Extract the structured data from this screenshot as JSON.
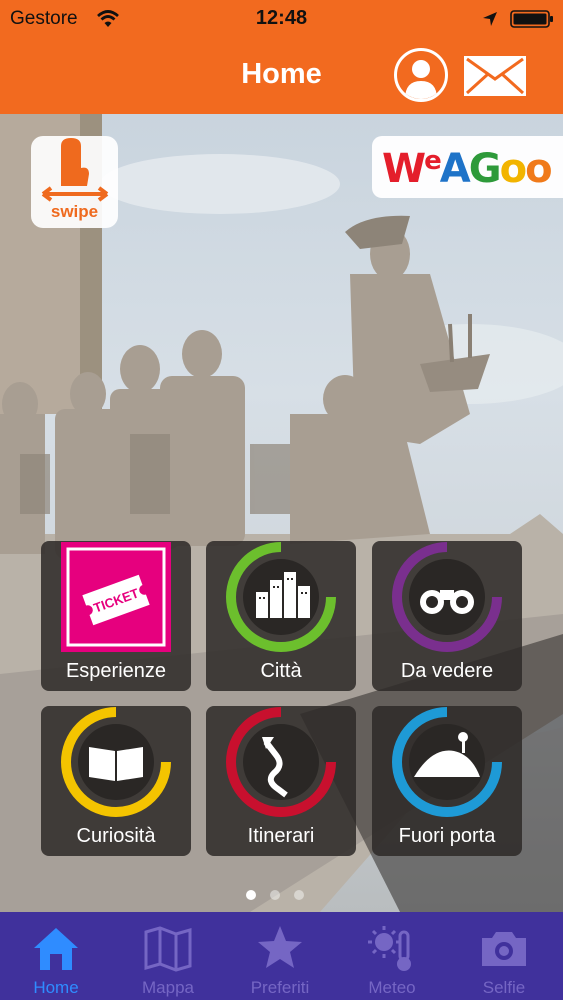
{
  "status_bar": {
    "carrier": "Gestore",
    "time": "12:48",
    "wifi_icon": "wifi-icon",
    "location_icon": "location-arrow-icon",
    "battery_icon": "battery-icon"
  },
  "header": {
    "title": "Home",
    "profile_icon": "user-icon",
    "mail_icon": "envelope-icon",
    "background_color": "#f26a1f"
  },
  "overlay": {
    "swipe_label": "swipe",
    "brand": [
      "W",
      "e",
      "A",
      "G",
      "o",
      "o"
    ]
  },
  "tiles": [
    {
      "label": "Esperienze",
      "icon": "ticket-icon",
      "color": "#e6007e"
    },
    {
      "label": "Città",
      "icon": "city-buildings-icon",
      "color": "#6cbf2d"
    },
    {
      "label": "Da vedere",
      "icon": "binoculars-icon",
      "color": "#7a2f8e"
    },
    {
      "label": "Curiosità",
      "icon": "open-book-icon",
      "color": "#f4c400"
    },
    {
      "label": "Itinerari",
      "icon": "winding-road-icon",
      "color": "#c8102e"
    },
    {
      "label": "Fuori porta",
      "icon": "landscape-icon",
      "color": "#1e9ad6"
    }
  ],
  "pager": {
    "count": 3,
    "active": 0
  },
  "tab_bar": {
    "background_color": "#40319c",
    "active_color": "#2f8cff",
    "items": [
      {
        "label": "Home",
        "icon": "home-icon",
        "active": true
      },
      {
        "label": "Mappa",
        "icon": "map-icon",
        "active": false
      },
      {
        "label": "Preferiti",
        "icon": "star-icon",
        "active": false
      },
      {
        "label": "Meteo",
        "icon": "weather-sun-thermometer-icon",
        "active": false
      },
      {
        "label": "Selfie",
        "icon": "camera-icon",
        "active": false
      }
    ]
  }
}
